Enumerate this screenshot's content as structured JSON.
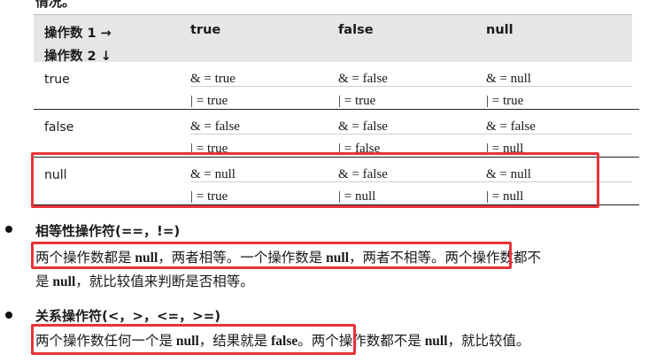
{
  "top_fragment": "情况。",
  "table": {
    "header": {
      "op1": "操作数 1 →",
      "op2": "操作数 2 ↓",
      "columns": [
        "true",
        "false",
        "null"
      ]
    },
    "rows": [
      {
        "label": "true",
        "and": [
          "& = true",
          "& = false",
          "& = null"
        ],
        "or": [
          "| = true",
          "| = true",
          "| = true"
        ]
      },
      {
        "label": "false",
        "and": [
          "& = false",
          "& = false",
          "& = false"
        ],
        "or": [
          "| = true",
          "| = false",
          "| = null"
        ]
      },
      {
        "label": "null",
        "and": [
          "& = null",
          "& = false",
          "& = null"
        ],
        "or": [
          "| = true",
          "| = null",
          "| = null"
        ]
      }
    ]
  },
  "section_equality": {
    "title": "相等性操作符(==，!=)",
    "line1_a": "两个操作数都是 ",
    "line1_b": "null",
    "line1_c": "，两者相等。一个操作数是 ",
    "line1_d": "null",
    "line1_e": "，两者不相等",
    "line1_f": "。两个操作数都不",
    "line2_a": "是 ",
    "line2_b": "null",
    "line2_c": "，就比较值来判断是否相等。"
  },
  "section_relational": {
    "title": "关系操作符(<，>，<=，>=)",
    "line1_a": "两个操作数任何一个是 ",
    "line1_b": "null",
    "line1_c": "，结果就是 ",
    "line1_d": "false",
    "line1_e": "。",
    "line1_f": "两个操作数都不是 ",
    "line1_g": "null",
    "line1_h": "，就比较值。"
  },
  "colors": {
    "highlight": "#e8333a",
    "header_bg": "#e6e6e6"
  }
}
